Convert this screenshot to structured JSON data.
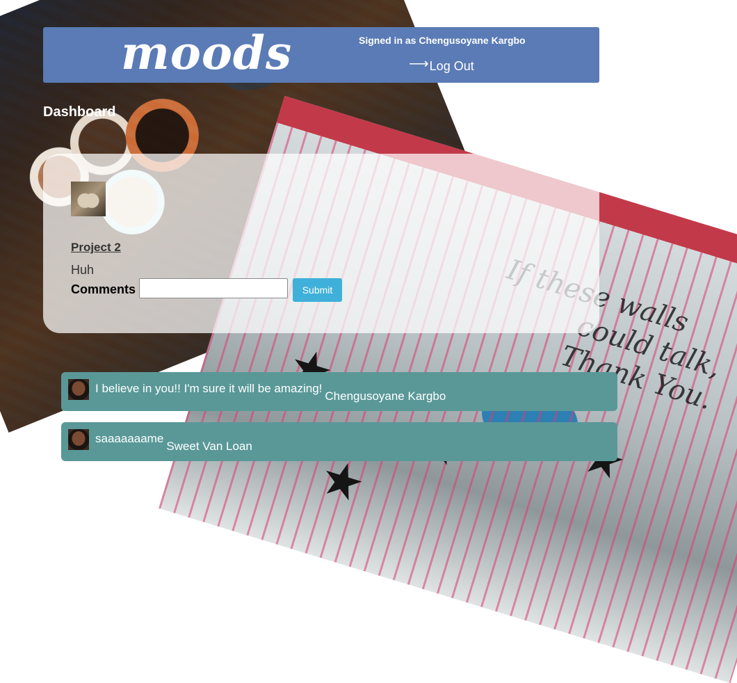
{
  "header": {
    "logo": "moods",
    "signed_in": "Signed in as Chengusoyane Kargbo",
    "logout_label": "Log Out",
    "logout_icon": "⟶",
    "color": "#5a7bb5"
  },
  "page_title": "Dashboard",
  "project": {
    "title": "Project 2",
    "description": "Huh",
    "comments_label": "Comments",
    "comment_input_value": "",
    "submit_label": "Submit"
  },
  "comments": [
    {
      "text": "I believe in you!! I'm sure it will be amazing!",
      "author": "Chengusoyane Kargbo"
    },
    {
      "text": "saaaaaaame",
      "author": "Sweet Van Loan"
    }
  ],
  "background": {
    "wall_text_1": "If these walls",
    "wall_text_2": "could talk,",
    "wall_text_3": "Thank You."
  },
  "colors": {
    "header": "#5a7bb5",
    "comment_bg": "#5a9898",
    "submit": "#3fb0d9"
  }
}
